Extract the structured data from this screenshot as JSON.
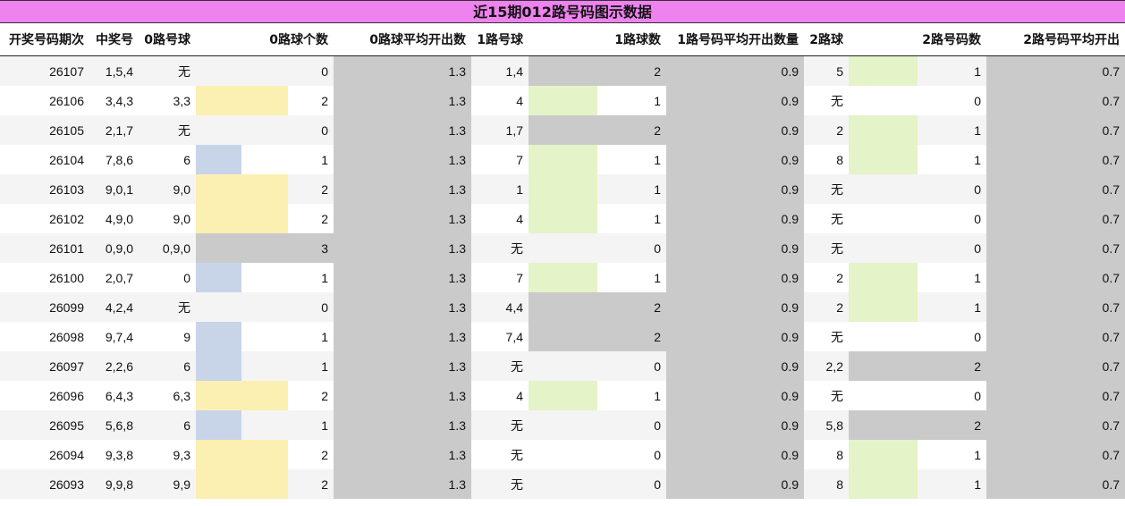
{
  "title": "近15期012路号码图示数据",
  "headers": [
    "开奖号码期次",
    "中奖号",
    "0路号球",
    "0路球个数",
    "0路球平均开出数",
    "1路号球",
    "1路球数",
    "1路号码平均开出数量",
    "2路球",
    "2路号码数",
    "2路号码平均开出"
  ],
  "colors": {
    "title_bg": "#ee82ee",
    "zero_bar": "#fbefb2",
    "zero_bar_one": "#c8d4e8",
    "one_bar": "#e4f3c8",
    "two_bar": "#e4f3c8",
    "grey": "#cacaca"
  },
  "rows": [
    {
      "issue": "26107",
      "nums": "1,5,4",
      "r0": "无",
      "c0": "0",
      "a0": "1.3",
      "r1": "1,4",
      "c1": "2",
      "a1": "0.9",
      "r2": "5",
      "c2": "1",
      "a2": "0.7"
    },
    {
      "issue": "26106",
      "nums": "3,4,3",
      "r0": "3,3",
      "c0": "2",
      "a0": "1.3",
      "r1": "4",
      "c1": "1",
      "a1": "0.9",
      "r2": "无",
      "c2": "0",
      "a2": "0.7"
    },
    {
      "issue": "26105",
      "nums": "2,1,7",
      "r0": "无",
      "c0": "0",
      "a0": "1.3",
      "r1": "1,7",
      "c1": "2",
      "a1": "0.9",
      "r2": "2",
      "c2": "1",
      "a2": "0.7"
    },
    {
      "issue": "26104",
      "nums": "7,8,6",
      "r0": "6",
      "c0": "1",
      "a0": "1.3",
      "r1": "7",
      "c1": "1",
      "a1": "0.9",
      "r2": "8",
      "c2": "1",
      "a2": "0.7"
    },
    {
      "issue": "26103",
      "nums": "9,0,1",
      "r0": "9,0",
      "c0": "2",
      "a0": "1.3",
      "r1": "1",
      "c1": "1",
      "a1": "0.9",
      "r2": "无",
      "c2": "0",
      "a2": "0.7"
    },
    {
      "issue": "26102",
      "nums": "4,9,0",
      "r0": "9,0",
      "c0": "2",
      "a0": "1.3",
      "r1": "4",
      "c1": "1",
      "a1": "0.9",
      "r2": "无",
      "c2": "0",
      "a2": "0.7"
    },
    {
      "issue": "26101",
      "nums": "0,9,0",
      "r0": "0,9,0",
      "c0": "3",
      "a0": "1.3",
      "r1": "无",
      "c1": "0",
      "a1": "0.9",
      "r2": "无",
      "c2": "0",
      "a2": "0.7"
    },
    {
      "issue": "26100",
      "nums": "2,0,7",
      "r0": "0",
      "c0": "1",
      "a0": "1.3",
      "r1": "7",
      "c1": "1",
      "a1": "0.9",
      "r2": "2",
      "c2": "1",
      "a2": "0.7"
    },
    {
      "issue": "26099",
      "nums": "4,2,4",
      "r0": "无",
      "c0": "0",
      "a0": "1.3",
      "r1": "4,4",
      "c1": "2",
      "a1": "0.9",
      "r2": "2",
      "c2": "1",
      "a2": "0.7"
    },
    {
      "issue": "26098",
      "nums": "9,7,4",
      "r0": "9",
      "c0": "1",
      "a0": "1.3",
      "r1": "7,4",
      "c1": "2",
      "a1": "0.9",
      "r2": "无",
      "c2": "0",
      "a2": "0.7"
    },
    {
      "issue": "26097",
      "nums": "2,2,6",
      "r0": "6",
      "c0": "1",
      "a0": "1.3",
      "r1": "无",
      "c1": "0",
      "a1": "0.9",
      "r2": "2,2",
      "c2": "2",
      "a2": "0.7"
    },
    {
      "issue": "26096",
      "nums": "6,4,3",
      "r0": "6,3",
      "c0": "2",
      "a0": "1.3",
      "r1": "4",
      "c1": "1",
      "a1": "0.9",
      "r2": "无",
      "c2": "0",
      "a2": "0.7"
    },
    {
      "issue": "26095",
      "nums": "5,6,8",
      "r0": "6",
      "c0": "1",
      "a0": "1.3",
      "r1": "无",
      "c1": "0",
      "a1": "0.9",
      "r2": "5,8",
      "c2": "2",
      "a2": "0.7"
    },
    {
      "issue": "26094",
      "nums": "9,3,8",
      "r0": "9,3",
      "c0": "2",
      "a0": "1.3",
      "r1": "无",
      "c1": "0",
      "a1": "0.9",
      "r2": "8",
      "c2": "1",
      "a2": "0.7"
    },
    {
      "issue": "26093",
      "nums": "9,9,8",
      "r0": "9,9",
      "c0": "2",
      "a0": "1.3",
      "r1": "无",
      "c1": "0",
      "a1": "0.9",
      "r2": "8",
      "c2": "1",
      "a2": "0.7"
    }
  ]
}
